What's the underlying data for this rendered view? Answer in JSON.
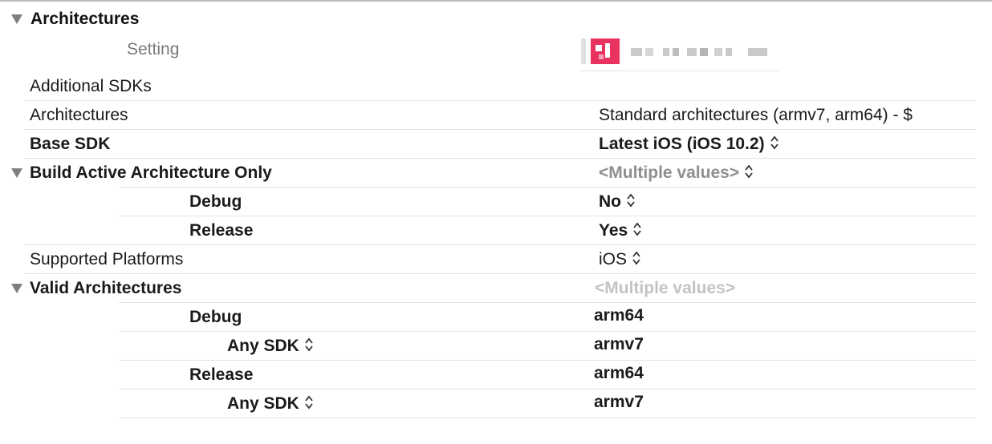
{
  "section": {
    "title": "Architectures"
  },
  "header": {
    "setting_label": "Setting"
  },
  "rows": {
    "additional_sdks": {
      "label": "Additional SDKs"
    },
    "architectures": {
      "label": "Architectures",
      "value": "Standard architectures (armv7, arm64)  -  $"
    },
    "base_sdk": {
      "label": "Base SDK",
      "value": "Latest iOS (iOS 10.2)"
    },
    "build_active": {
      "label": "Build Active Architecture Only",
      "value": "<Multiple values>"
    },
    "build_active_debug": {
      "label": "Debug",
      "value": "No"
    },
    "build_active_release": {
      "label": "Release",
      "value": "Yes"
    },
    "supported_platforms": {
      "label": "Supported Platforms",
      "value": "iOS"
    },
    "valid_archs": {
      "label": "Valid Architectures",
      "value": "<Multiple values>"
    },
    "valid_debug": {
      "label": "Debug",
      "value": "arm64"
    },
    "valid_debug_any": {
      "label": "Any SDK",
      "value": "armv7"
    },
    "valid_release": {
      "label": "Release",
      "value": "arm64"
    },
    "valid_release_any": {
      "label": "Any SDK",
      "value": "armv7"
    }
  },
  "colors": {
    "target_icon": "#e8325f",
    "text": "#1a1a1a",
    "muted": "#8f8f8f",
    "separator": "#e3e3e3"
  },
  "icons": {
    "disclosure": "disclosure-triangle-icon",
    "stepper": "up-down-stepper-icon",
    "target": "target-app-icon"
  }
}
